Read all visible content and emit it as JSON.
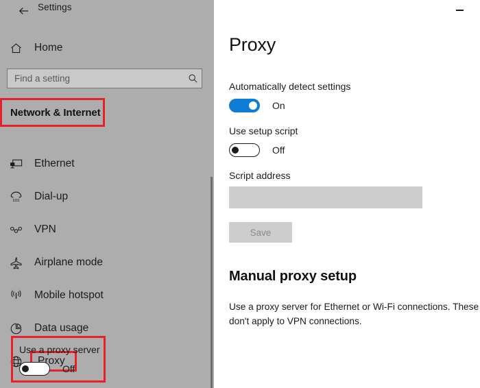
{
  "window": {
    "app_title": "Settings",
    "back_icon": "back-arrow-icon",
    "minimize_label": "Minimize"
  },
  "sidebar": {
    "home": {
      "label": "Home",
      "icon": "home-icon"
    },
    "search": {
      "placeholder": "Find a setting",
      "value": "",
      "icon": "search-icon"
    },
    "category": {
      "label": "Network & Internet",
      "highlighted": true
    },
    "items": [
      {
        "label": "Ethernet",
        "icon": "ethernet-icon",
        "highlighted": false
      },
      {
        "label": "Dial-up",
        "icon": "dialup-phone-icon",
        "highlighted": false
      },
      {
        "label": "VPN",
        "icon": "vpn-icon",
        "highlighted": false
      },
      {
        "label": "Airplane mode",
        "icon": "airplane-icon",
        "highlighted": false
      },
      {
        "label": "Mobile hotspot",
        "icon": "mobile-hotspot-icon",
        "highlighted": false
      },
      {
        "label": "Data usage",
        "icon": "pie-chart-icon",
        "highlighted": false
      },
      {
        "label": "Proxy",
        "icon": "globe-icon",
        "highlighted": true
      }
    ]
  },
  "main": {
    "page_title": "Proxy",
    "auto_detect": {
      "label": "Automatically detect settings",
      "state": "On",
      "on": true
    },
    "setup_script": {
      "label": "Use setup script",
      "state": "Off",
      "on": false
    },
    "script_address": {
      "label": "Script address",
      "value": "",
      "placeholder": "",
      "disabled": true
    },
    "save_button": {
      "label": "Save",
      "disabled": true
    },
    "manual_section": {
      "heading": "Manual proxy setup",
      "description": "Use a proxy server for Ethernet or Wi-Fi connections. These don't apply to VPN connections.",
      "use_proxy_server": {
        "label": "Use a proxy server",
        "state": "Off",
        "on": false,
        "highlighted": true
      }
    }
  },
  "colors": {
    "accent_blue": "#0c7cd5",
    "annotation_red": "#e8202a",
    "sidebar_bg": "#adadad",
    "disabled_gray": "#cdcdcd"
  }
}
